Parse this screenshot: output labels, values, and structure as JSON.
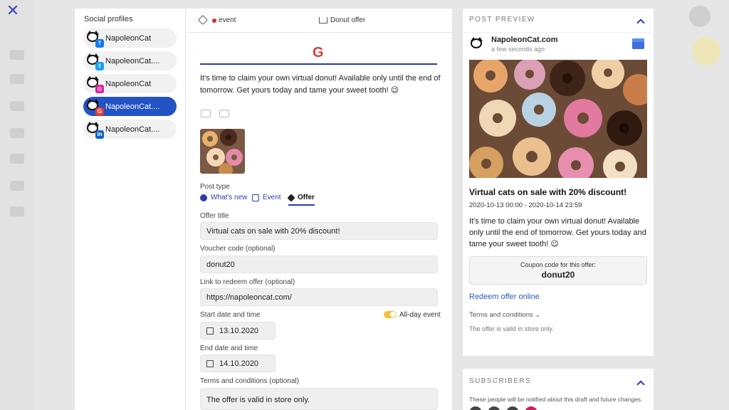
{
  "close_icon": "close-icon",
  "profiles": {
    "title": "Social profiles",
    "items": [
      {
        "label": "NapoleonCat",
        "network": "facebook",
        "badge": "f",
        "color": "#1877f2",
        "active": false
      },
      {
        "label": "NapoleonCat....",
        "network": "twitter",
        "badge": "t",
        "color": "#1da1f2",
        "active": false
      },
      {
        "label": "NapoleonCat",
        "network": "instagram",
        "badge": "◎",
        "color": "#d6249f",
        "active": false
      },
      {
        "label": "NapoleonCat....",
        "network": "google",
        "badge": "G",
        "color": "#e53935",
        "active": true
      },
      {
        "label": "NapoleonCat....",
        "network": "linkedin",
        "badge": "in",
        "color": "#0a66c2",
        "active": false
      }
    ]
  },
  "editor": {
    "tabs": {
      "event": "event",
      "offer": "Donut offer"
    },
    "logo": "G",
    "post_text": "It's time to claim your own virtual donut! Available only until the end of tomorrow. Get yours today and tame your sweet tooth! 😉",
    "post_type_label": "Post type",
    "post_types": {
      "whats_new": "What's new",
      "event": "Event",
      "offer": "Offer"
    },
    "offer_title_label": "Offer title",
    "offer_title": "Virtual cats on sale with 20% discount!",
    "voucher_label": "Voucher code (optional)",
    "voucher": "donut20",
    "link_label": "Link to redeem offer (optional)",
    "link": "https://napoleoncat.com/",
    "start_label": "Start date and time",
    "start_date": "13.10.2020",
    "all_day": "All-day event",
    "end_label": "End date and time",
    "end_date": "14.10.2020",
    "terms_label": "Terms and conditions (optional)",
    "terms": "The offer is valid in store only."
  },
  "preview": {
    "title": "POST PREVIEW",
    "account": "NapoleonCat.com",
    "time": "a few seconds ago",
    "offer_title": "Virtual cats on sale with 20% discount!",
    "dates": "2020-10-13 00:00 - 2020-10-14 23:59",
    "text": "It's time to claim your own virtual donut! Available only until the end of tomorrow. Get yours today and tame your sweet tooth! 😉",
    "coupon_label": "Coupon code for this offer:",
    "coupon_code": "donut20",
    "redeem": "Redeem offer online",
    "terms_toggle": "Terms and conditions ⌄",
    "terms_text": "The offer is valid in store only."
  },
  "subscribers": {
    "title": "SUBSCRIBERS",
    "description": "These people will be notified about this draft and future changes."
  }
}
